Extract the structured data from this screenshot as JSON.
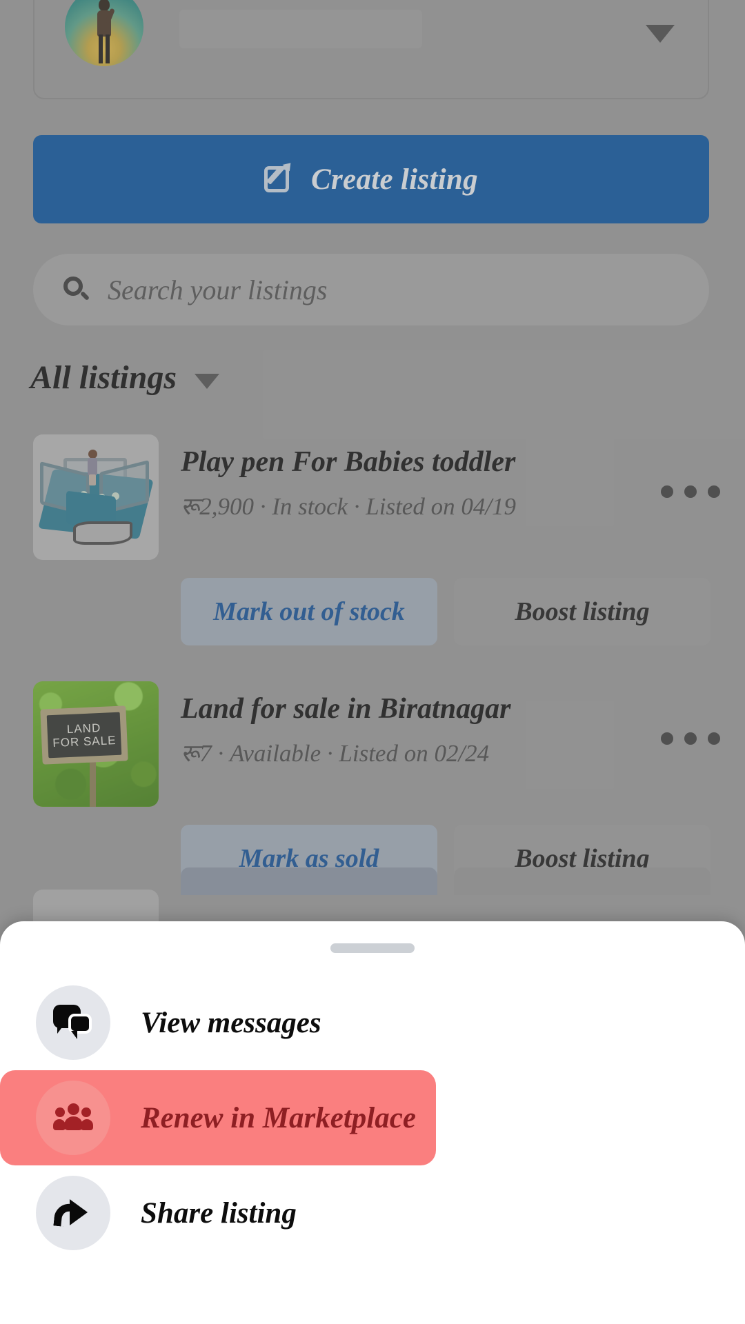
{
  "account": {
    "avatar_name": "profile-avatar",
    "name_value": "",
    "caret_name": "dropdown-caret"
  },
  "create": {
    "label": "Create listing",
    "icon": "compose-pencil-icon",
    "color": "#0b57a4"
  },
  "search": {
    "placeholder": "Search your listings",
    "value": "",
    "icon": "search-icon"
  },
  "section": {
    "title": "All listings",
    "caret": "chevron-down-icon"
  },
  "listings": [
    {
      "title": "Play pen For Babies toddler",
      "meta": "रू​2,900 · In stock · Listed on 04/19",
      "price": "रू2,900",
      "status": "In stock",
      "listed_on": "Listed on 04/19",
      "thumb": "playpen-photo",
      "primary_action": "Mark out of stock",
      "secondary_action": "Boost listing",
      "overflow": "more-options-icon"
    },
    {
      "title": "Land for sale in Biratnagar",
      "meta": "रू7 · Available · Listed on 02/24",
      "price": "रू7",
      "status": "Available",
      "listed_on": "Listed on 02/24",
      "thumb": "land-for-sale-photo",
      "thumb_text_line1": "LAND",
      "thumb_text_line2": "FOR SALE",
      "primary_action": "Mark as sold",
      "secondary_action": "Boost listing",
      "overflow": "more-options-icon"
    }
  ],
  "sheet": {
    "grabber": "drag-handle",
    "items": [
      {
        "label": "View messages",
        "icon": "chat-bubbles-icon",
        "highlighted": false
      },
      {
        "label": "Renew in Marketplace",
        "icon": "people-group-icon",
        "highlighted": true
      },
      {
        "label": "Share listing",
        "icon": "share-arrow-icon",
        "highlighted": false
      }
    ],
    "highlight_color": "#fa7f7f",
    "highlight_text_color": "#8e1f23"
  }
}
